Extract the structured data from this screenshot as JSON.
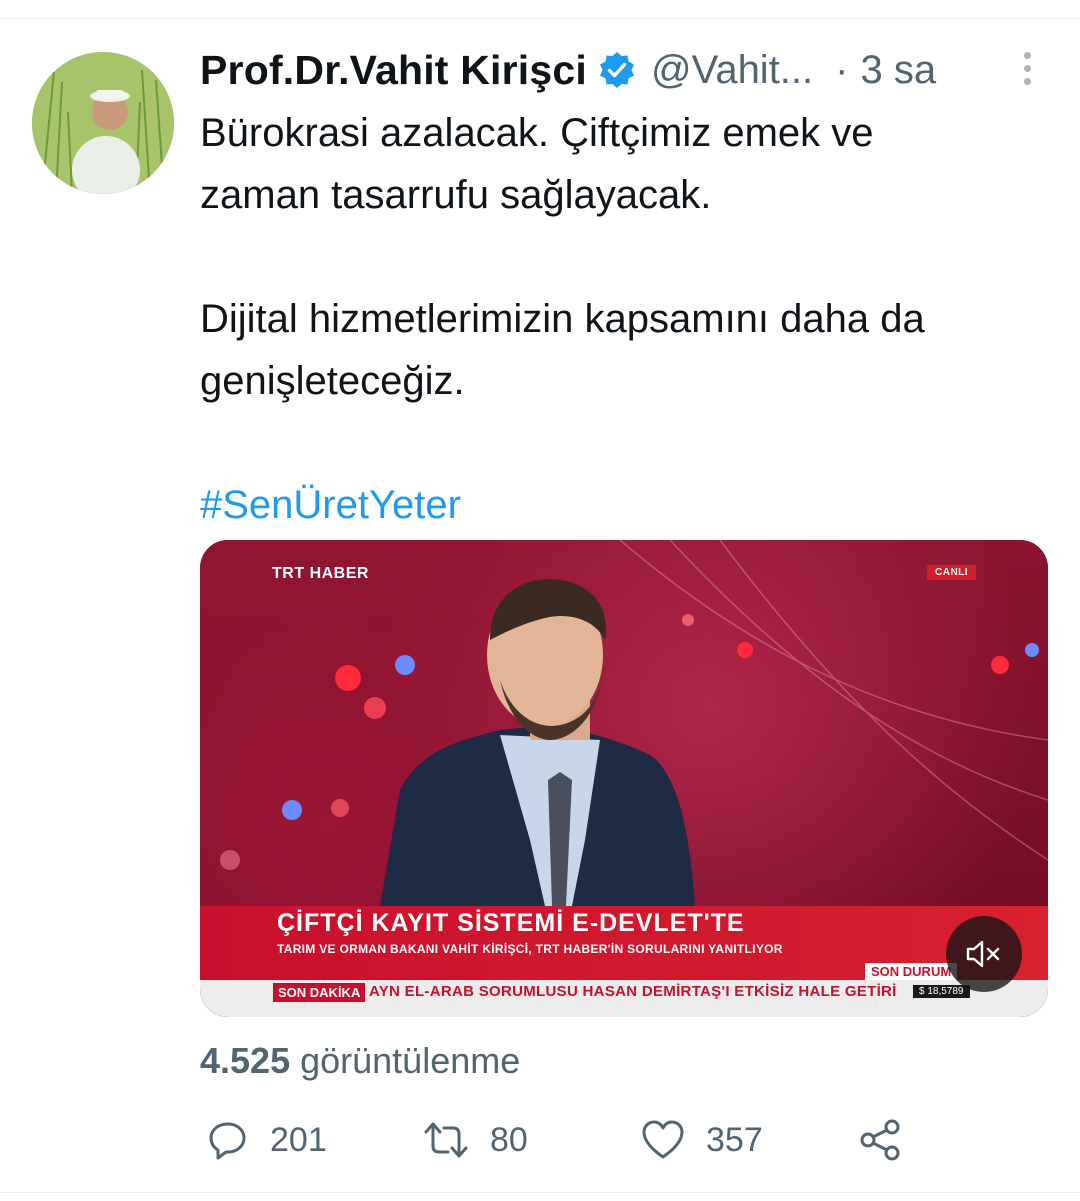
{
  "tweet": {
    "author_name": "Prof.Dr.Vahit Kirişci",
    "handle": "@Vahit...",
    "separator": "·",
    "time": "3 sa",
    "lines": [
      "Bürokrasi azalacak. Çiftçimiz emek ve",
      "zaman tasarrufu sağlayacak.",
      "Dijital hizmetlerimizin kapsamını daha da",
      "genişleteceğiz."
    ],
    "hashtag": "#SenÜretYeter"
  },
  "video": {
    "channel_logo_trt": "TRT",
    "channel_logo_haber": "HABER",
    "live_label": "CANLI",
    "headline": "ÇİFTÇİ KAYIT SİSTEMİ E-DEVLET'TE",
    "subheadline": "TARIM VE ORMAN BAKANI VAHİT KİRİŞCİ, TRT HABER'İN SORULARINI YANITLIYOR",
    "son_durum": "SON DURUM",
    "son_dakika": "SON DAKİKA",
    "ticker": "AYN EL-ARAB SORUMLUSU HASAN DEMİRTAŞ'I ETKİSİZ HALE GETİRİ",
    "currency": "$ 18,5789",
    "mute_icon": "speaker-muted-icon"
  },
  "stats": {
    "views_count": "4.525",
    "views_label": "görüntülenme"
  },
  "actions": {
    "reply_count": "201",
    "retweet_count": "80",
    "like_count": "357"
  },
  "colors": {
    "accent": "#1d9bf0",
    "secondary_text": "#536471",
    "primary_text": "#0f1419",
    "news_red": "#c8102e"
  }
}
